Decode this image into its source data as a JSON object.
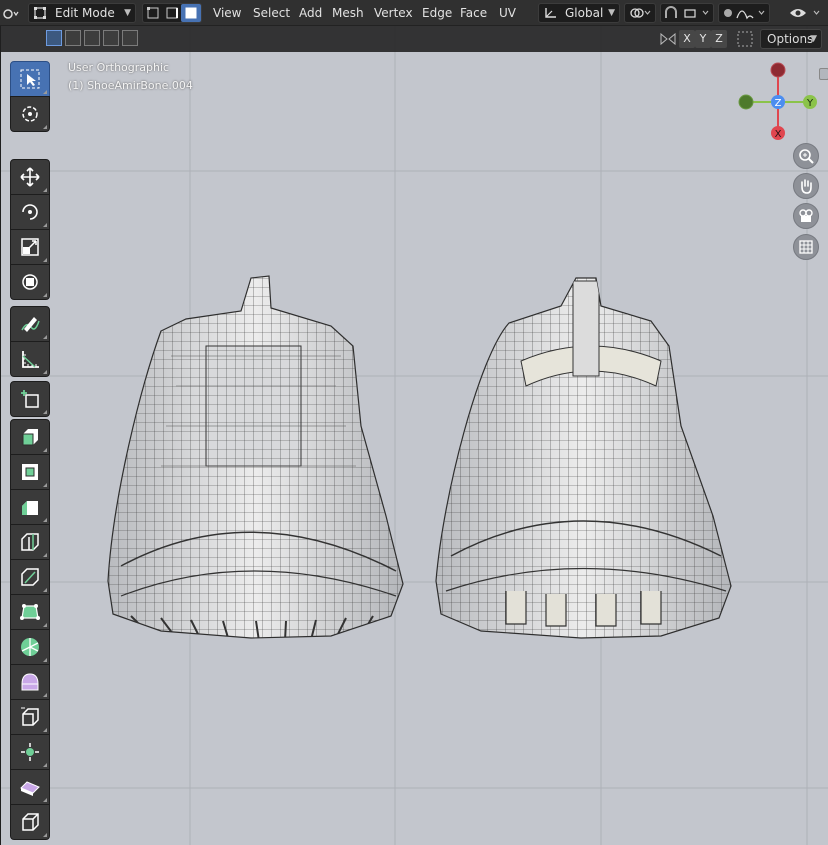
{
  "header": {
    "mode_label": "Edit Mode",
    "menus": [
      "View",
      "Select",
      "Add",
      "Mesh",
      "Vertex",
      "Edge",
      "Face",
      "UV"
    ],
    "transform_orientation": "Global"
  },
  "viewport_header": {
    "axes": [
      "X",
      "Y",
      "Z"
    ],
    "options_label": "Options"
  },
  "viewport": {
    "view_name": "User Orthographic",
    "object_name": "(1) ShoeAmirBone.004"
  },
  "gizmo": {
    "z_label": "Z",
    "y_label": "Y",
    "x_label": "X",
    "colors": {
      "x": "#e0464f",
      "y": "#8bc34a",
      "z": "#4c8df0"
    }
  },
  "toolbar": {
    "tools": [
      "select-box-tool",
      "cursor-tool",
      "move-tool",
      "rotate-tool",
      "scale-tool",
      "transform-tool",
      "annotate-tool",
      "measure-tool",
      "add-cube-tool",
      "extrude-region-tool",
      "inset-faces-tool",
      "bevel-tool",
      "loop-cut-tool",
      "knife-tool",
      "poly-build-tool",
      "spin-tool",
      "smooth-tool",
      "edge-slide-tool",
      "shrink-fatten-tool",
      "shear-tool",
      "rip-region-tool"
    ]
  },
  "colors": {
    "accent": "#4772b3",
    "viewport_bg": "#c3c6cd"
  }
}
